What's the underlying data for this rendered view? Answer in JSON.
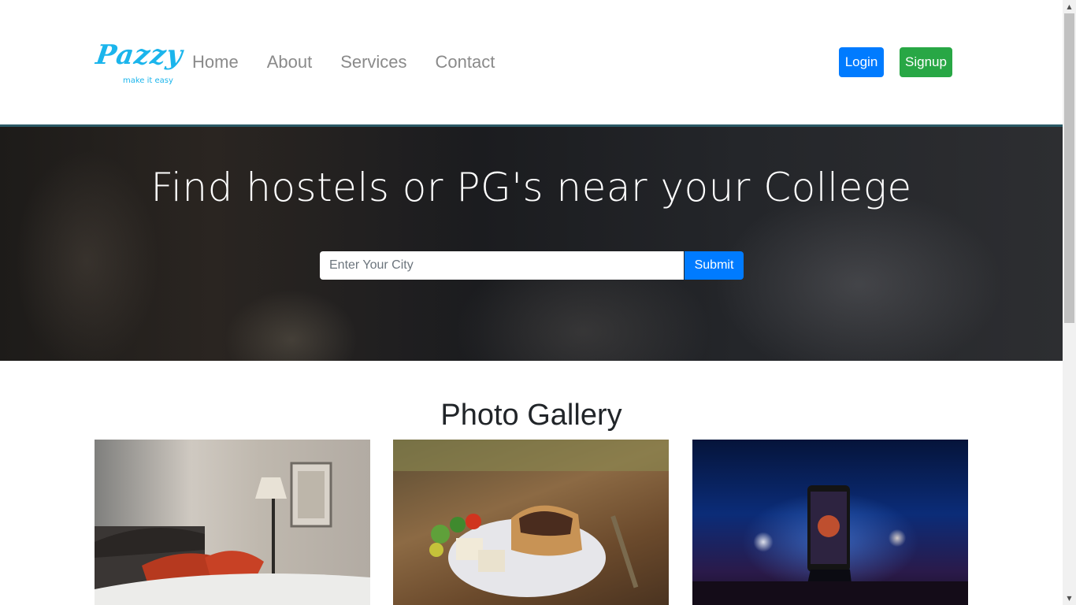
{
  "brand": {
    "name": "Pazzy",
    "tagline": "make it easy",
    "color": "#1bb5ec"
  },
  "nav": {
    "links": [
      {
        "label": "Home"
      },
      {
        "label": "About"
      },
      {
        "label": "Services"
      },
      {
        "label": "Contact"
      }
    ],
    "login_label": "Login",
    "signup_label": "Signup"
  },
  "hero": {
    "title": "Find hostels or PG's near your College",
    "search_placeholder": "Enter Your City",
    "search_value": "",
    "submit_label": "Submit"
  },
  "gallery": {
    "title": "Photo Gallery",
    "photos": [
      {
        "subject": "bedroom"
      },
      {
        "subject": "food-plate"
      },
      {
        "subject": "concert-phone"
      }
    ]
  },
  "colors": {
    "primary": "#007bff",
    "success": "#28a745",
    "nav_text": "#8a8a8a"
  }
}
